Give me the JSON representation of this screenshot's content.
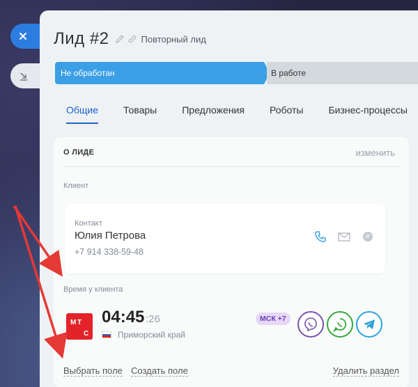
{
  "side": {
    "close_icon": "close-icon",
    "collapse_icon": "collapse-icon"
  },
  "header": {
    "title": "Лид #2",
    "subtitle": "Повторный лид"
  },
  "stages": [
    {
      "label": "Не обработан",
      "color": "#3b9fe6"
    },
    {
      "label": "В работе",
      "color": "#d4d9de"
    }
  ],
  "tabs": [
    {
      "label": "Общие",
      "active": true
    },
    {
      "label": "Товары"
    },
    {
      "label": "Предложения"
    },
    {
      "label": "Роботы"
    },
    {
      "label": "Бизнес-процессы"
    }
  ],
  "section": {
    "heading": "О ЛИДЕ",
    "edit_link": "изменить",
    "client_label": "Клиент",
    "contact": {
      "label": "Контакт",
      "name": "Юлия Петрова",
      "phone": "+7 914 338-59-48"
    },
    "client_time": {
      "label": "Время у клиента",
      "time": "04:45",
      "seconds": ":26",
      "region": "Приморский край",
      "tz_badge": "МСК +7"
    },
    "messengers": [
      "Viber",
      "WhatsApp",
      "Telegram"
    ],
    "links": {
      "select_field": "Выбрать поле",
      "create_field": "Создать поле",
      "delete_section": "Удалить раздел"
    }
  },
  "colors": {
    "accent": "#1a62c8",
    "operator_logo": "#e3232a",
    "annotation_arrow": "#e53935"
  }
}
